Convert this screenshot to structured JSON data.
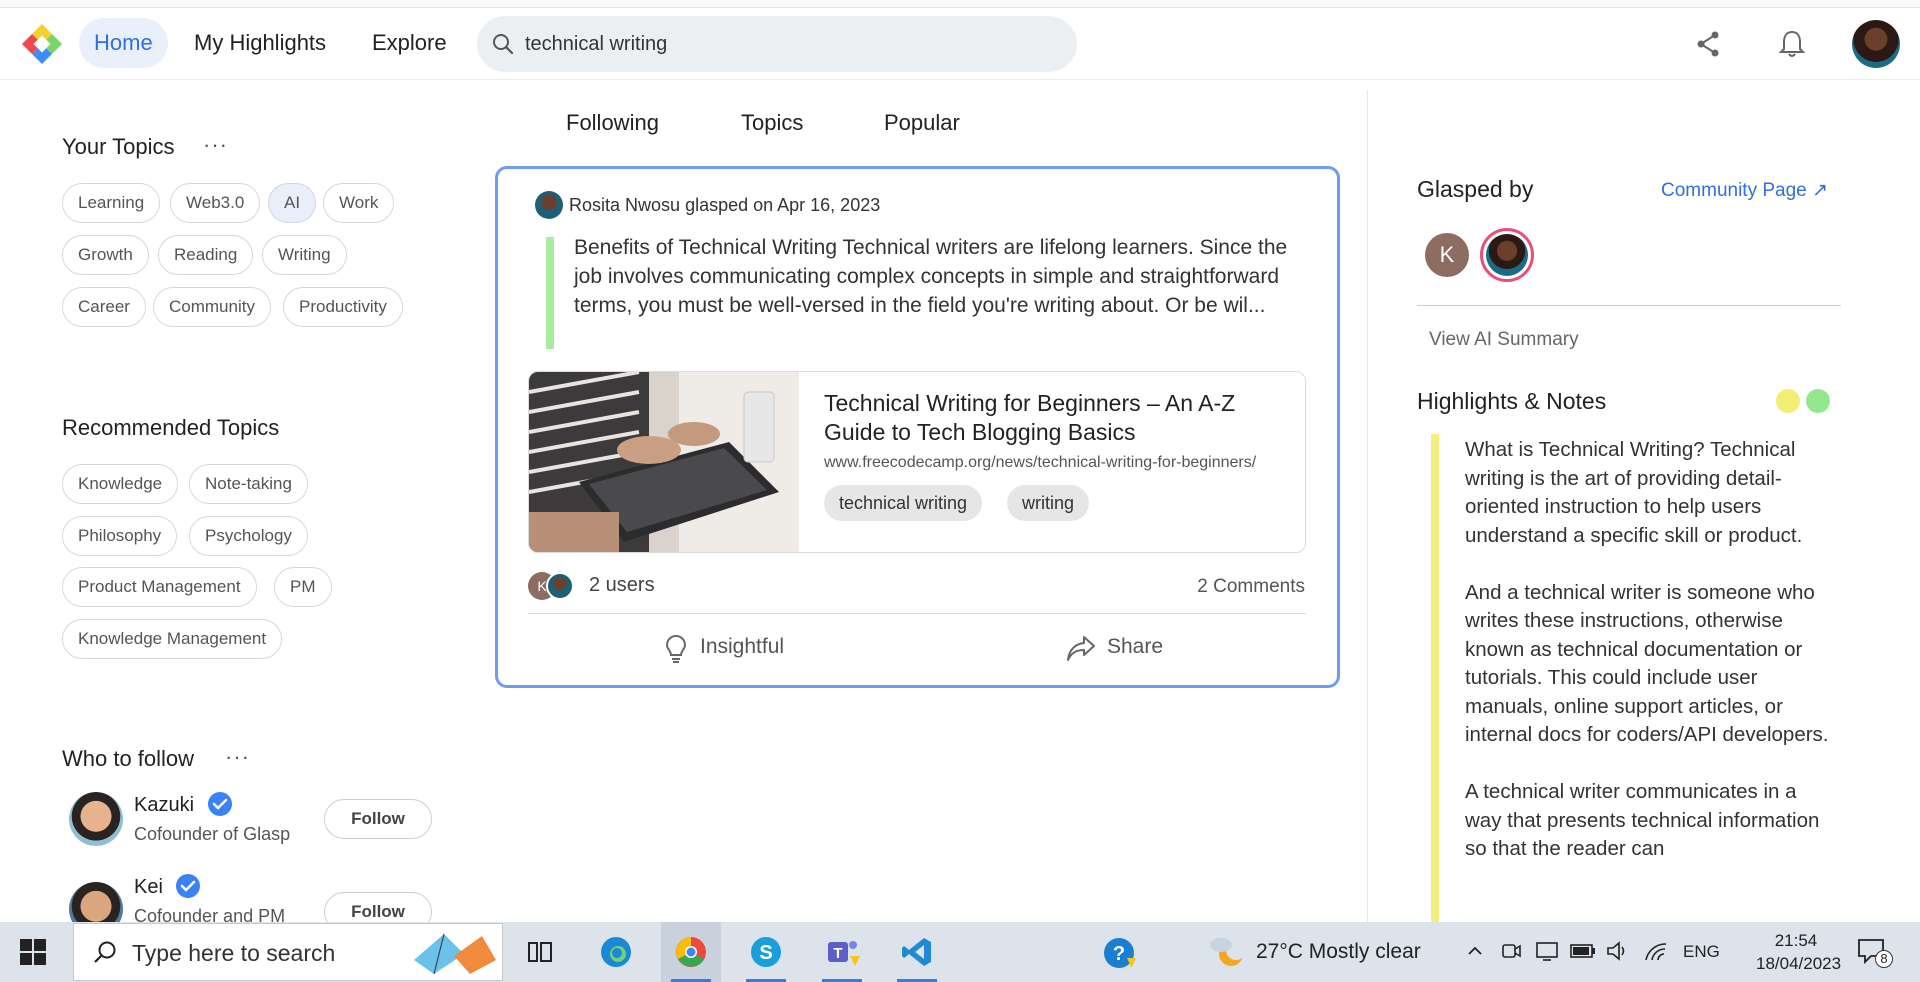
{
  "header": {
    "nav": [
      "Home",
      "My Highlights",
      "Explore"
    ],
    "search_value": "technical writing"
  },
  "left": {
    "your_topics_title": "Your Topics",
    "menu_dots": "···",
    "your_topics": [
      "Learning",
      "Web3.0",
      "AI",
      "Work",
      "Growth",
      "Reading",
      "Writing",
      "Career",
      "Community",
      "Productivity"
    ],
    "active_topic": "AI",
    "recommended_title": "Recommended Topics",
    "recommended": [
      "Knowledge",
      "Note-taking",
      "Philosophy",
      "Psychology",
      "Product Management",
      "PM",
      "Knowledge Management"
    ],
    "who_to_follow_title": "Who to follow",
    "people": [
      {
        "name": "Kazuki",
        "role": "Cofounder of Glasp",
        "button": "Follow"
      },
      {
        "name": "Kei",
        "role": "Cofounder and PM",
        "button": "Follow"
      }
    ]
  },
  "feed": {
    "tabs": [
      "Following",
      "Topics",
      "Popular"
    ],
    "post": {
      "user": "Rosita Nwosu",
      "action": "glasped on Apr 16, 2023",
      "quote": "Benefits of Technical Writing Technical writers are lifelong learners. Since the job involves communicating complex concepts in simple and straightforward terms, you must be well-versed in the field you're writing about. Or be wil...",
      "link_title": "Technical Writing for Beginners – An A-Z Guide to Tech Blogging Basics",
      "link_url": "www.freecodecamp.org/news/technical-writing-for-beginners/",
      "tags": [
        "technical writing",
        "writing"
      ],
      "users_count": "2 users",
      "comments": "2 Comments",
      "avatar_initial": "K",
      "actions": [
        "Insightful",
        "Share"
      ]
    }
  },
  "right": {
    "glasped_by": "Glasped by",
    "community_link": "Community Page ↗",
    "avatar_initial": "K",
    "view_ai_summary": "View AI Summary",
    "highlights_title": "Highlights & Notes",
    "dot_colors": [
      "#f4ee72",
      "#93e88e"
    ],
    "note_paragraphs": [
      "What is Technical Writing? Technical writing is the art of providing detail-oriented instruction to help users understand a specific skill or product.",
      "And a technical writer is someone who writes these instructions, otherwise known as technical documentation or tutorials. This could include user manuals, online support articles, or internal docs for coders/API developers.",
      "A technical writer communicates in a way that presents technical information so that the reader can"
    ]
  },
  "taskbar": {
    "search_placeholder": "Type here to search",
    "weather": "27°C  Mostly clear",
    "language": "ENG",
    "time": "21:54",
    "date": "18/04/2023",
    "notifications": "8"
  }
}
